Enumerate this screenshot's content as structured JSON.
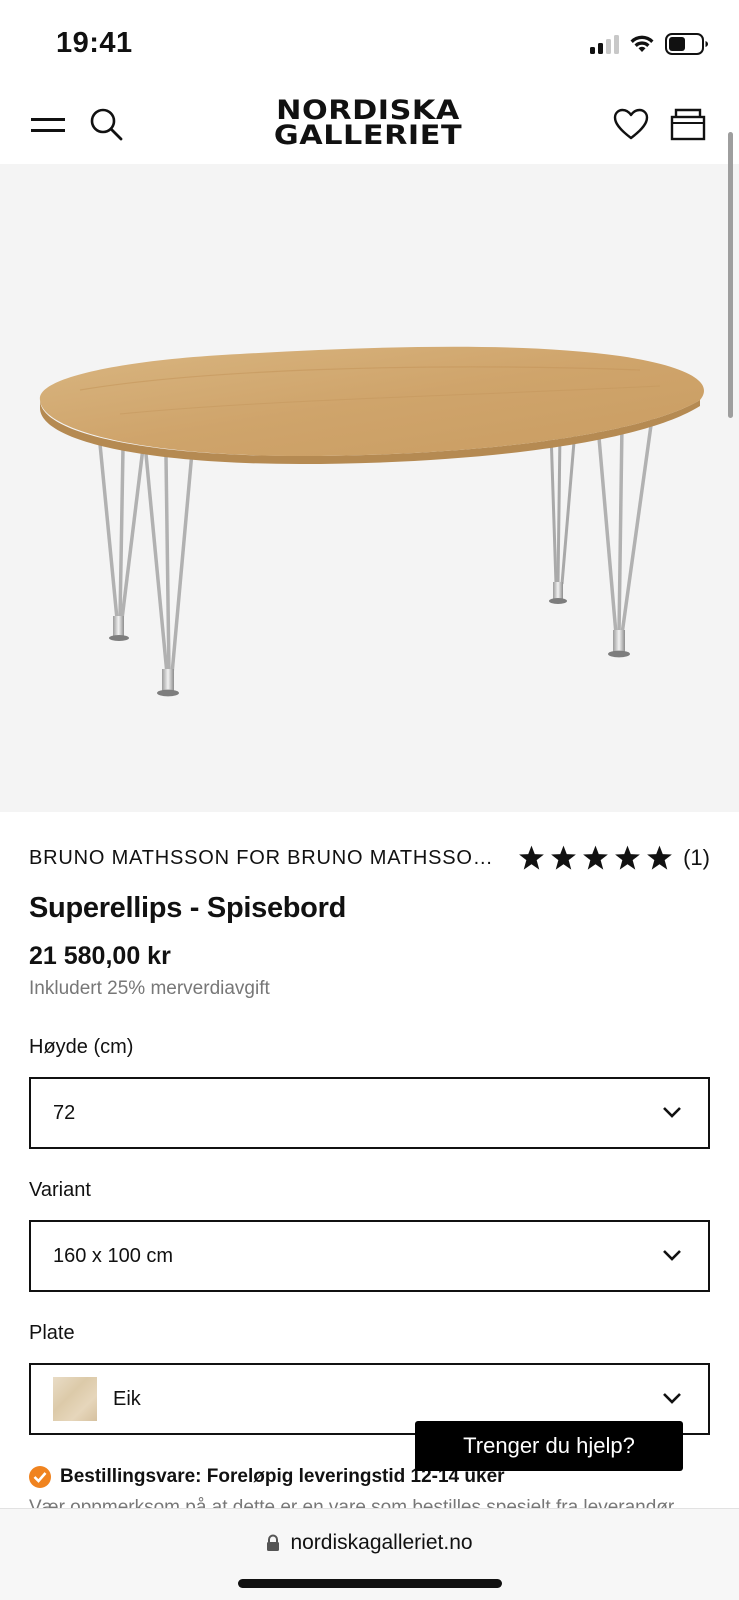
{
  "status_bar": {
    "time": "19:41"
  },
  "header": {
    "logo_line1": "NORDISKA",
    "logo_line2": "GALLERIET",
    "icons": [
      "menu-icon",
      "search-icon",
      "heart-icon",
      "bag-icon"
    ]
  },
  "product": {
    "brand": "BRUNO MATHSSON FOR BRUNO MATHSSON I...",
    "rating_stars": 5,
    "review_count": "(1)",
    "title": "Superellips - Spisebord",
    "price": "21 580,00 kr",
    "vat_note": "Inkludert 25% merverdiavgift"
  },
  "options": {
    "height": {
      "label": "Høyde (cm)",
      "value": "72"
    },
    "variant": {
      "label": "Variant",
      "value": "160 x 100 cm"
    },
    "plate": {
      "label": "Plate",
      "value": "Eik"
    }
  },
  "help_button": "Trenger du hjelp?",
  "delivery": {
    "text": "Bestillingsvare: Foreløpig leveringstid 12-14 uker",
    "badge_color": "#f0831f",
    "truncated_line": "Vær oppmerksom på at dette er en vare som bestilles spesielt fra leverandør"
  },
  "browser": {
    "url": "nordiskagalleriet.no"
  }
}
